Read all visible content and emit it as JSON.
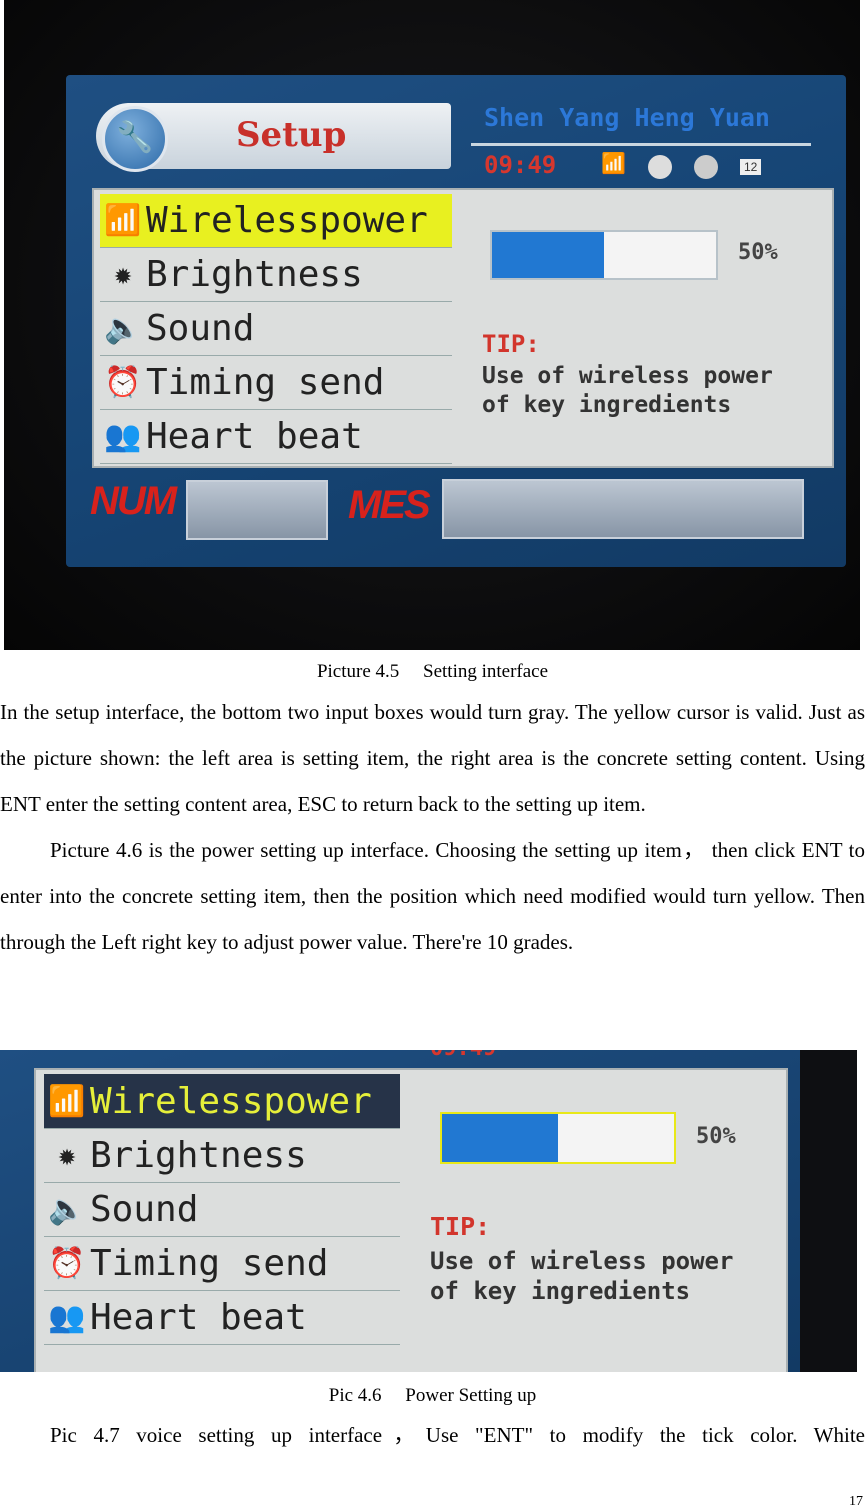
{
  "screen": {
    "title": "Setup",
    "brand": "Shen Yang Heng Yuan",
    "time": "09:49",
    "status_badge": "12",
    "menu": [
      {
        "label": "Wirelesspower",
        "icon": "wifi-icon"
      },
      {
        "label": "Brightness",
        "icon": "sun-icon"
      },
      {
        "label": "Sound",
        "icon": "speaker-icon"
      },
      {
        "label": "Timing send",
        "icon": "alarm-clock-icon"
      },
      {
        "label": "Heart beat",
        "icon": "people-icon"
      }
    ],
    "power_level_percent": 50,
    "power_label": "50%",
    "tip_title": "TIP:",
    "tip_line1": "Use of wireless power",
    "tip_line2": "of key ingredients",
    "num_label": "NUM",
    "mes_label": "MES",
    "colors": {
      "cursor_yellow": "#e8f020",
      "bar_blue": "#2178d2",
      "header_blue": "#1a4a7c"
    }
  },
  "captions": {
    "fig1": "Picture 4.5　 Setting interface",
    "fig2": "Pic 4.6　 Power Setting up"
  },
  "paragraphs": {
    "p1": "In the setup interface, the bottom two input boxes would turn gray. The yellow cursor is valid. Just as the picture shown: the left area is setting item, the right area is the concrete setting content. Using ENT enter the setting content area, ESC to return back to the setting up item.",
    "p2": "Picture 4.6 is the power setting up interface. Choosing the setting up item， then click ENT to enter into the concrete setting item, then the position which need modified would turn yellow. Then through the Left right key to adjust power value. There're 10 grades.",
    "p3": "Pic 4.7 voice setting up interface，Use \"ENT\" to modify the tick color. White"
  },
  "page_number": "17"
}
